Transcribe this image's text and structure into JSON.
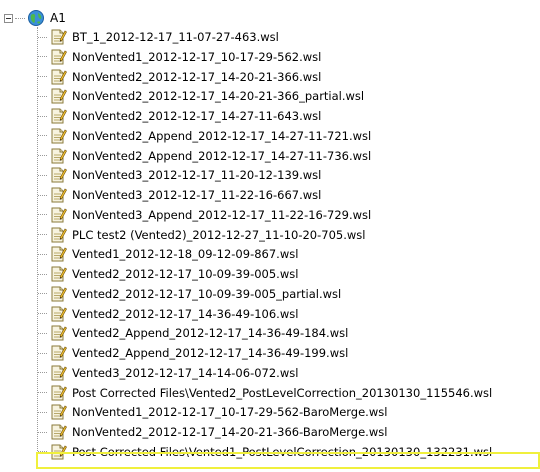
{
  "root": {
    "label": "A1",
    "icon": "globe-icon"
  },
  "files": [
    "BT_1_2012-12-17_11-07-27-463.wsl",
    "NonVented1_2012-12-17_10-17-29-562.wsl",
    "NonVented2_2012-12-17_14-20-21-366.wsl",
    "NonVented2_2012-12-17_14-20-21-366_partial.wsl",
    "NonVented2_2012-12-17_14-27-11-643.wsl",
    "NonVented2_Append_2012-12-17_14-27-11-721.wsl",
    "NonVented2_Append_2012-12-17_14-27-11-736.wsl",
    "NonVented3_2012-12-17_11-20-12-139.wsl",
    "NonVented3_2012-12-17_11-22-16-667.wsl",
    "NonVented3_Append_2012-12-17_11-22-16-729.wsl",
    "PLC test2 (Vented2)_2012-12-27_11-10-20-705.wsl",
    "Vented1_2012-12-18_09-12-09-867.wsl",
    "Vented2_2012-12-17_10-09-39-005.wsl",
    "Vented2_2012-12-17_10-09-39-005_partial.wsl",
    "Vented2_2012-12-17_14-36-49-106.wsl",
    "Vented2_Append_2012-12-17_14-36-49-184.wsl",
    "Vented2_Append_2012-12-17_14-36-49-199.wsl",
    "Vented3_2012-12-17_14-14-06-072.wsl",
    "Post Corrected Files\\Vented2_PostLevelCorrection_20130130_115546.wsl",
    "NonVented1_2012-12-17_10-17-29-562-BaroMerge.wsl",
    "NonVented2_2012-12-17_14-20-21-366-BaroMerge.wsl",
    "Post Corrected Files\\Vented1_PostLevelCorrection_20130130_132231.wsl"
  ],
  "selected_index": 21,
  "colors": {
    "highlight": "#f0f03c",
    "tree_lines": "#9a9a9a"
  }
}
